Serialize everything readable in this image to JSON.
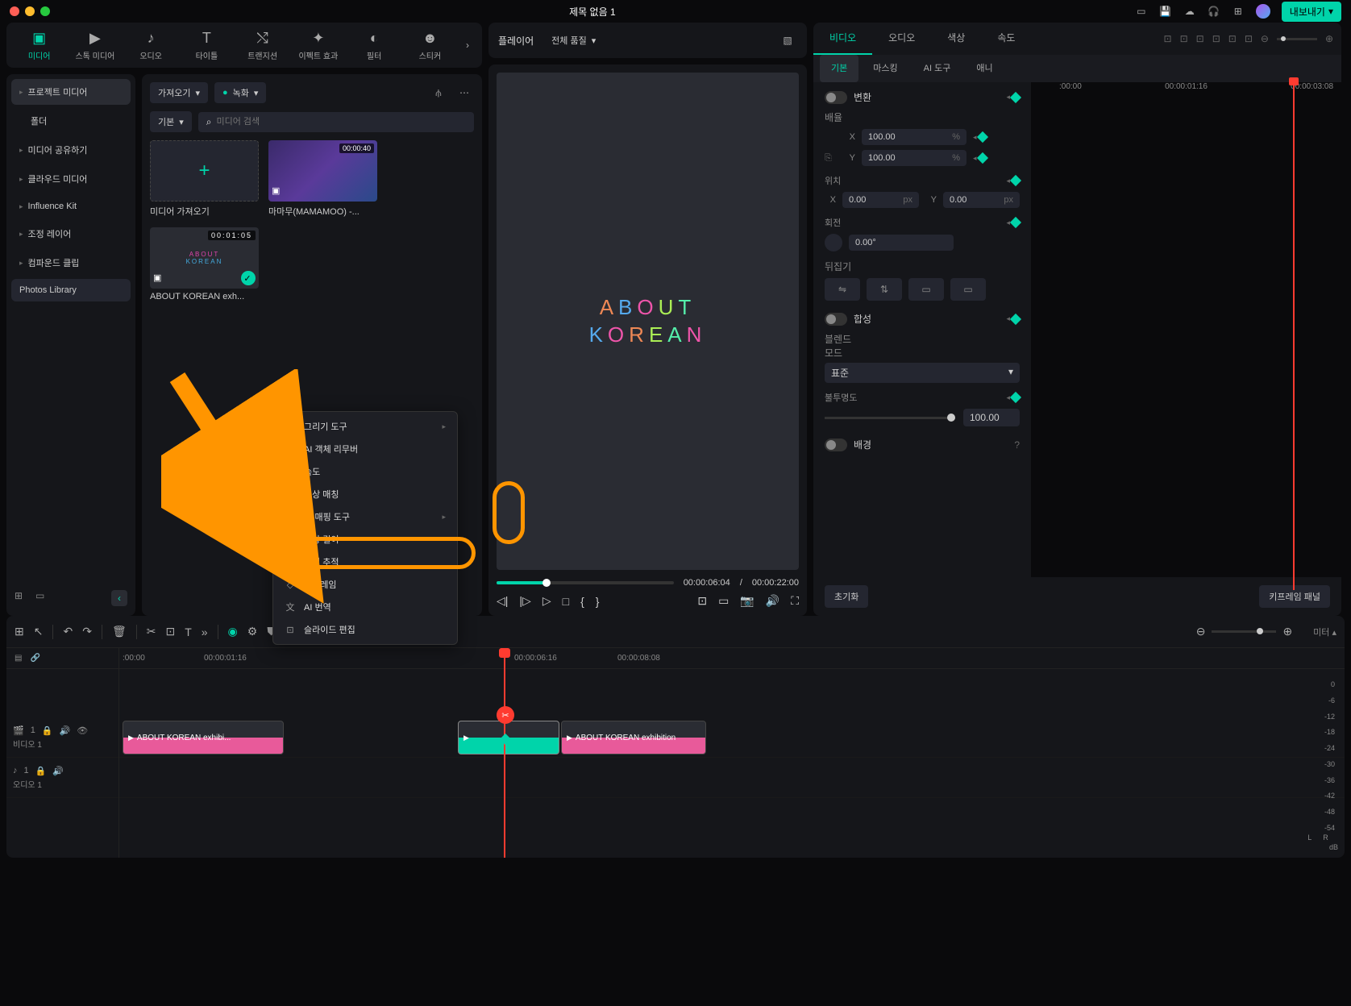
{
  "window": {
    "title": "제목 없음 1"
  },
  "titlebar": {
    "export": "내보내기"
  },
  "tabs": {
    "media": "미디어",
    "stock": "스톡 미디어",
    "audio": "오디오",
    "title": "타이틀",
    "transition": "트랜지션",
    "effect": "이펙트 효과",
    "filter": "필터",
    "sticker": "스티커"
  },
  "sidebar": {
    "project_media": "프로젝트 미디어",
    "folder": "폴더",
    "share": "미디어 공유하기",
    "cloud": "클라우드 미디어",
    "influence": "Influence Kit",
    "adjust": "조정 레이어",
    "compound": "컴파운드 클립",
    "photos": "Photos Library"
  },
  "media_toolbar": {
    "import": "가져오기",
    "record": "녹화",
    "basic": "기본",
    "search_ph": "미디어 검색"
  },
  "thumbs": {
    "import_label": "미디어 가져오기",
    "clip1_dur": "00:00:40",
    "clip1_label": "마마무(MAMAMOO) -...",
    "clip2_dur": "00:01:05",
    "clip2_label": "ABOUT KOREAN exh...",
    "about_l1": "ABOUT",
    "about_l2": "KOREAN"
  },
  "player": {
    "label": "플레이어",
    "quality": "전체 품질",
    "about": "ABOUT",
    "korean": "KOREAN",
    "cur": "00:00:06:04",
    "sep": "/",
    "total": "00:00:22:00"
  },
  "inspector": {
    "tabs": {
      "video": "비디오",
      "audio": "오디오",
      "color": "색상",
      "speed": "속도"
    },
    "subtabs": {
      "basic": "기본",
      "mask": "마스킹",
      "ai": "AI 도구",
      "anim": "애니"
    },
    "transform": "변환",
    "scale": "배율",
    "x": "X",
    "y": "Y",
    "scale_x": "100.00",
    "scale_y": "100.00",
    "pct": "%",
    "position": "위치",
    "pos_x": "0.00",
    "pos_y": "0.00",
    "px": "px",
    "rotation": "회전",
    "rot_val": "0.00°",
    "flip": "뒤집기",
    "compose": "합성",
    "blend": "블렌드 모드",
    "blend_val": "표준",
    "opacity": "불투명도",
    "opacity_val": "100.00",
    "background": "배경",
    "reset": "초기화",
    "kf_panel": "키프레임 패널",
    "ruler": {
      "t1": ":00:00",
      "t2": "00:00:01:16",
      "t3": "00:00:03:08"
    }
  },
  "timeline": {
    "meter_label": "미터",
    "ruler": {
      "t0": ":00:00",
      "t1": "00:00:01:16",
      "t2": "00:00:06:16",
      "t3": "00:00:08:08"
    },
    "track_video": "비디오 1",
    "track_audio": "오디오 1",
    "clip1": "ABOUT KOREAN exhibi...",
    "clip3": "ABOUT KOREAN exhibition",
    "meter": {
      "vals": [
        "0",
        "-6",
        "-12",
        "-18",
        "-24",
        "-30",
        "-36",
        "-42",
        "-48",
        "-54"
      ],
      "l": "L",
      "r": "R",
      "db": "dB"
    }
  },
  "context_menu": {
    "draw": "그리기 도구",
    "ai_remove": "AI 객체 리무버",
    "speed": "속도",
    "color_match": "색상 매칭",
    "ai_map": "AI 매핑 도구",
    "video_len": "영상 길이",
    "motion_track": "모션 추적",
    "keyframe": "키프레임",
    "ai_translate": "AI 번역",
    "slide_edit": "슬라이드 편집"
  }
}
